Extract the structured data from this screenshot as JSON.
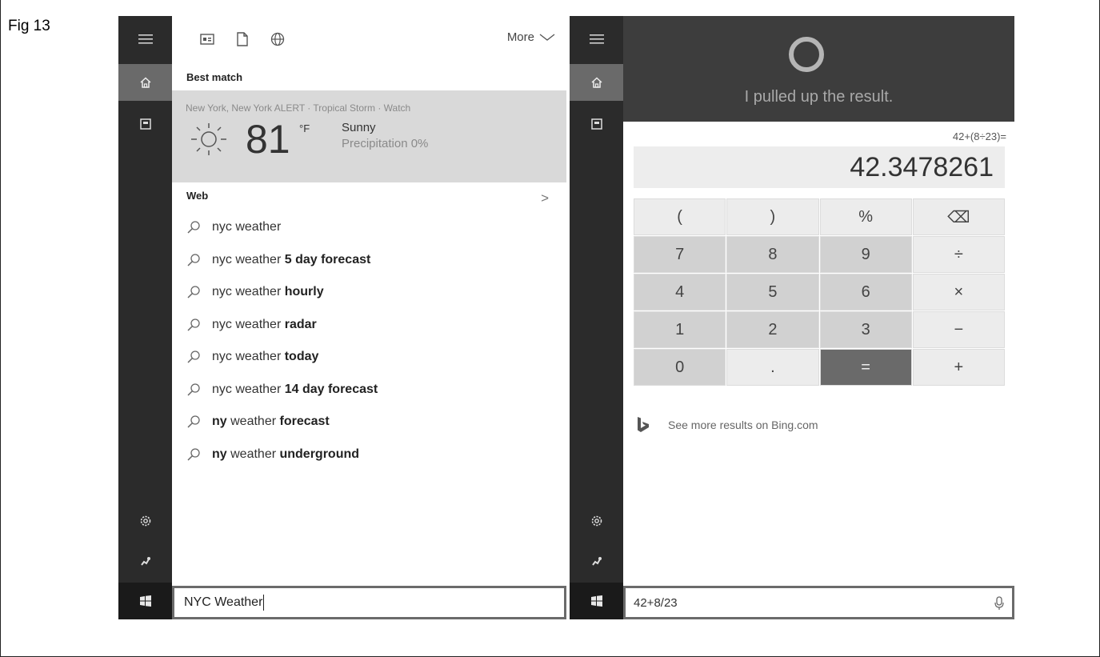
{
  "figure_label": "Fig 13",
  "left_panel": {
    "toolbar": {
      "more_label": "More"
    },
    "best_match_heading": "Best match",
    "weather": {
      "location_line": "New York, New York  ALERT · Tropical Storm · Watch",
      "temperature": "81",
      "unit": "°F",
      "condition": "Sunny",
      "precipitation": "Precipitation 0%"
    },
    "web_heading": "Web",
    "suggestions": [
      {
        "plain": "nyc weather",
        "bold": ""
      },
      {
        "plain": "nyc weather ",
        "bold": "5 day forecast"
      },
      {
        "plain": "nyc weather ",
        "bold": "hourly"
      },
      {
        "plain": "nyc weather ",
        "bold": "radar"
      },
      {
        "plain": "nyc weather ",
        "bold": "today"
      },
      {
        "plain": "nyc weather ",
        "bold": "14 day forecast"
      },
      {
        "bold_first": "ny",
        "plain": " weather ",
        "bold": "forecast"
      },
      {
        "bold_first": "ny",
        "plain": " weather ",
        "bold": "underground"
      }
    ],
    "search_value": "NYC Weather"
  },
  "right_panel": {
    "cortana_message": "I pulled up the result.",
    "expression": "42+(8÷23)=",
    "result": "42.3478261",
    "keys": [
      "(",
      ")",
      "%",
      "⌫",
      "7",
      "8",
      "9",
      "÷",
      "4",
      "5",
      "6",
      "×",
      "1",
      "2",
      "3",
      "−",
      "0",
      ".",
      "=",
      "+"
    ],
    "bing_link": "See more results on Bing.com",
    "query_value": "42+8/23"
  },
  "colors": {
    "sidebar": "#2b2b2b",
    "sidebar_active": "#6a6a6a",
    "weather_card": "#d9d9d9",
    "cortana_header": "#3d3d3d",
    "equals_key": "#6a6a6a"
  }
}
